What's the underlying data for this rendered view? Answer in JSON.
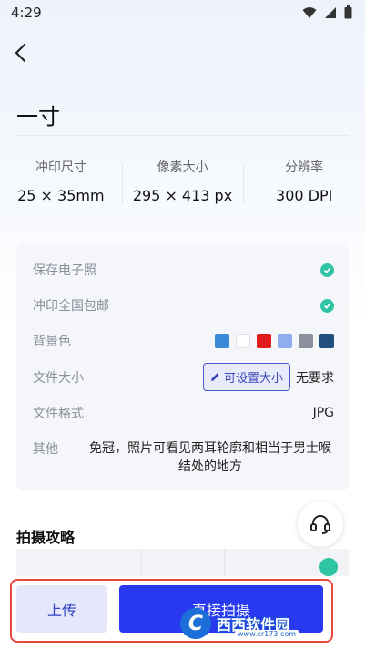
{
  "status_bar": {
    "time": "4:29"
  },
  "header": {
    "title": "一寸"
  },
  "specs": [
    {
      "label": "冲印尺寸",
      "value": "25 × 35mm"
    },
    {
      "label": "像素大小",
      "value": "295 × 413 px"
    },
    {
      "label": "分辨率",
      "value": "300 DPI"
    }
  ],
  "details": {
    "save_digital": "保存电子照",
    "free_shipping": "冲印全国包邮",
    "background_label": "背景色",
    "background_colors": [
      "#3b8ad8",
      "#ffffff",
      "#e21b1b",
      "#8eaef0",
      "#8b909c",
      "#22507e"
    ],
    "file_size_label": "文件大小",
    "file_size_button": "可设置大小",
    "file_size_value": "无要求",
    "file_format_label": "文件格式",
    "file_format_value": "JPG",
    "other_label": "其他",
    "other_value": "免冠，照片可看见两耳轮廓和相当于男士喉结处的地方"
  },
  "tips": {
    "title": "拍摄攻略"
  },
  "actions": {
    "upload": "上传",
    "shoot": "直接拍摄"
  },
  "watermark": {
    "brand": "西西软件园",
    "url": "www.cr173.com"
  },
  "colors": {
    "primary": "#2839f0",
    "accent_check": "#2ec4a4",
    "highlight": "#e8453c"
  }
}
